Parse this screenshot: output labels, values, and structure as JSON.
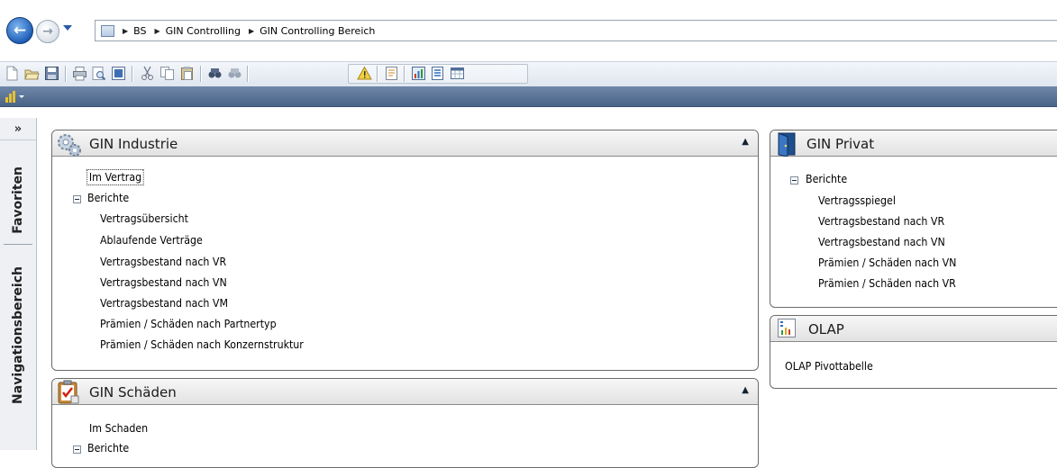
{
  "address_bar": {
    "breadcrumb": [
      "BS",
      "GIN Controlling",
      "GIN Controlling Bereich"
    ]
  },
  "sidebar": {
    "expand_label": "»",
    "tabs": [
      "Favoriten",
      "Navigationsbereich"
    ]
  },
  "panels": {
    "industrie": {
      "title": "GIN Industrie",
      "top_item": "Im Vertrag",
      "group_label": "Berichte",
      "items": [
        "Vertragsübersicht",
        "Ablaufende Verträge",
        "Vertragsbestand nach VR",
        "Vertragsbestand nach VN",
        "Vertragsbestand nach VM",
        "Prämien / Schäden nach Partnertyp",
        "Prämien / Schäden nach Konzernstruktur"
      ]
    },
    "schaeden": {
      "title": "GIN Schäden",
      "top_item": "Im Schaden",
      "group_label": "Berichte"
    },
    "privat": {
      "title": "GIN Privat",
      "group_label": "Berichte",
      "items": [
        "Vertragsspiegel",
        "Vertragsbestand nach VR",
        "Vertragsbestand nach VN",
        "Prämien / Schäden nach VN",
        "Prämien / Schäden nach VR"
      ]
    },
    "olap": {
      "title": "OLAP",
      "items": [
        "OLAP Pivottabelle"
      ]
    }
  },
  "icons": {
    "toolbar": [
      "new-document-icon",
      "open-folder-icon",
      "save-icon",
      "print-icon",
      "print-preview-icon",
      "page-setup-icon",
      "cut-icon",
      "copy-icon",
      "paste-icon",
      "find-icon",
      "find-next-icon",
      "alert-icon",
      "report-icon",
      "chart-report-icon",
      "list-icon",
      "table-icon"
    ]
  },
  "colors": {
    "dark_strip": "#55708f",
    "panel_border": "#6b6b6b",
    "link_blue": "#1f5fb8"
  }
}
